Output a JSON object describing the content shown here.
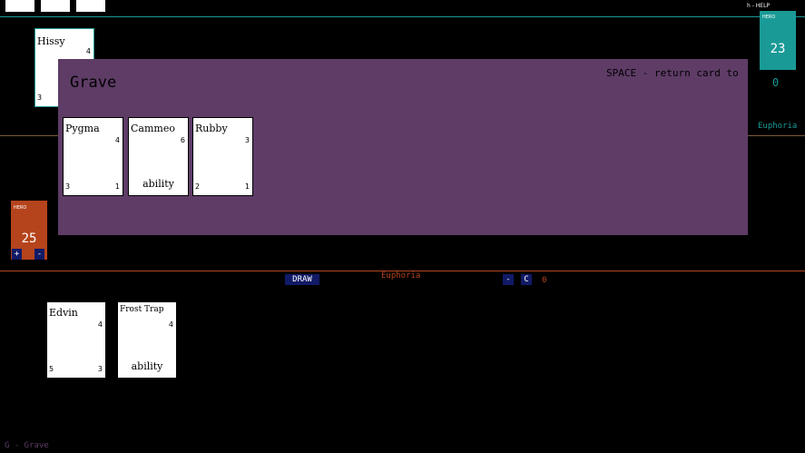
{
  "help_hint": "h - HELP",
  "grave_hint": "G - Grave",
  "opponent": {
    "hero_label": "HERO",
    "hero_health": "23",
    "counter": "0",
    "name": "Euphoria",
    "color": "#1a9a96",
    "card_in_play": {
      "name": "Hissy",
      "cost": "4",
      "attack": "3"
    }
  },
  "player": {
    "hero_label": "HERO",
    "hero_health": "25",
    "plus": "+",
    "minus": "-",
    "name": "Euphoria",
    "color": "#b5441c",
    "counter": "0"
  },
  "controls": {
    "draw": "DRAW",
    "minus": "-",
    "c": "C"
  },
  "hand": [
    {
      "name": "Edvin",
      "cost": "4",
      "attack": "5",
      "health": "3"
    },
    {
      "name": "Frost Trap",
      "cost": "4",
      "ability": "ability"
    }
  ],
  "grave_modal": {
    "title": "Grave",
    "hint": "SPACE - return card to",
    "bg_color": "#5e3c66",
    "cards": [
      {
        "name": "Pygma",
        "cost": "4",
        "attack": "3",
        "health": "1"
      },
      {
        "name": "Cammeo",
        "cost": "6",
        "ability": "ability"
      },
      {
        "name": "Rubby",
        "cost": "3",
        "attack": "2",
        "health": "1"
      }
    ]
  }
}
